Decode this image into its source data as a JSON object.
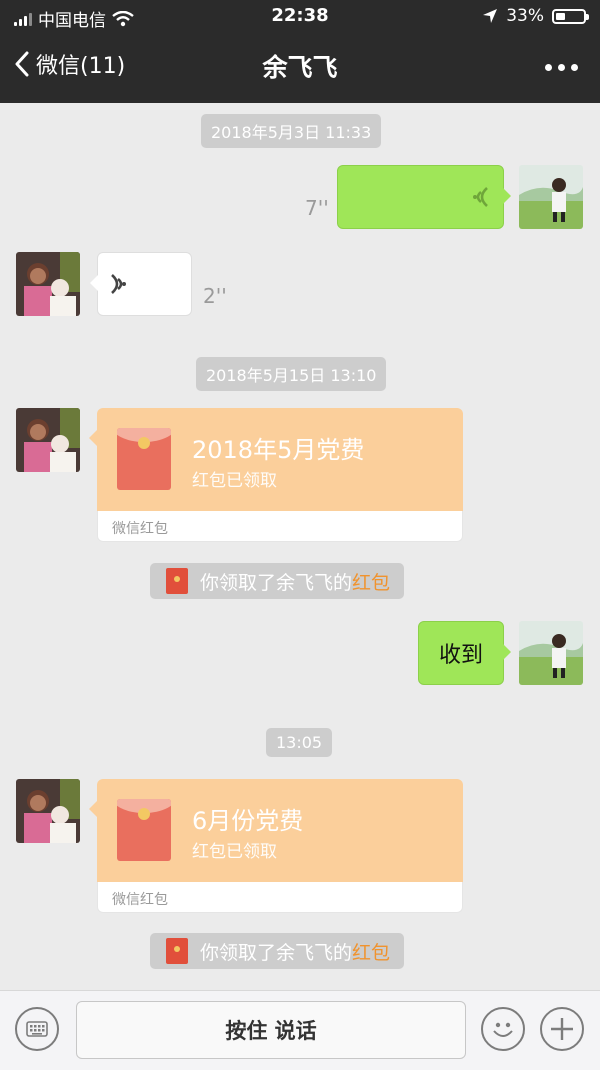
{
  "status_bar": {
    "carrier": "中国电信",
    "time": "22:38",
    "battery": "33%",
    "battery_level": 0.33
  },
  "nav": {
    "back_label": "微信(11)",
    "title": "余飞飞"
  },
  "messages": {
    "time1": "2018年5月3日 11:33",
    "voice_out_duration": "7''",
    "voice_in_duration": "2''",
    "time2": "2018年5月15日 13:10",
    "redpacket1": {
      "title": "2018年5月党费",
      "status": "红包已领取",
      "footer": "微信红包"
    },
    "notice1": {
      "prefix": "你领取了余飞飞的",
      "link": "红包"
    },
    "text_out": "收到",
    "time3": "13:05",
    "redpacket2": {
      "title": "6月份党费",
      "status": "红包已领取",
      "footer": "微信红包"
    },
    "notice2": {
      "prefix": "你领取了余飞飞的",
      "link": "红包"
    }
  },
  "input_bar": {
    "hold_to_talk": "按住 说话"
  },
  "icons": {
    "back": "chevron-left-icon",
    "more": "more-icon",
    "voice": "voice-wave-icon",
    "keyboard": "keyboard-icon",
    "emoji": "emoji-icon",
    "add": "plus-icon",
    "wifi": "wifi-icon",
    "location": "location-arrow-icon",
    "signal": "signal-icon",
    "battery": "battery-icon"
  },
  "colors": {
    "header": "#2b2b2b",
    "green_bubble": "#9fe658",
    "redpacket": "#fbcf9b",
    "link": "#f0932e",
    "background": "#ebebeb"
  }
}
